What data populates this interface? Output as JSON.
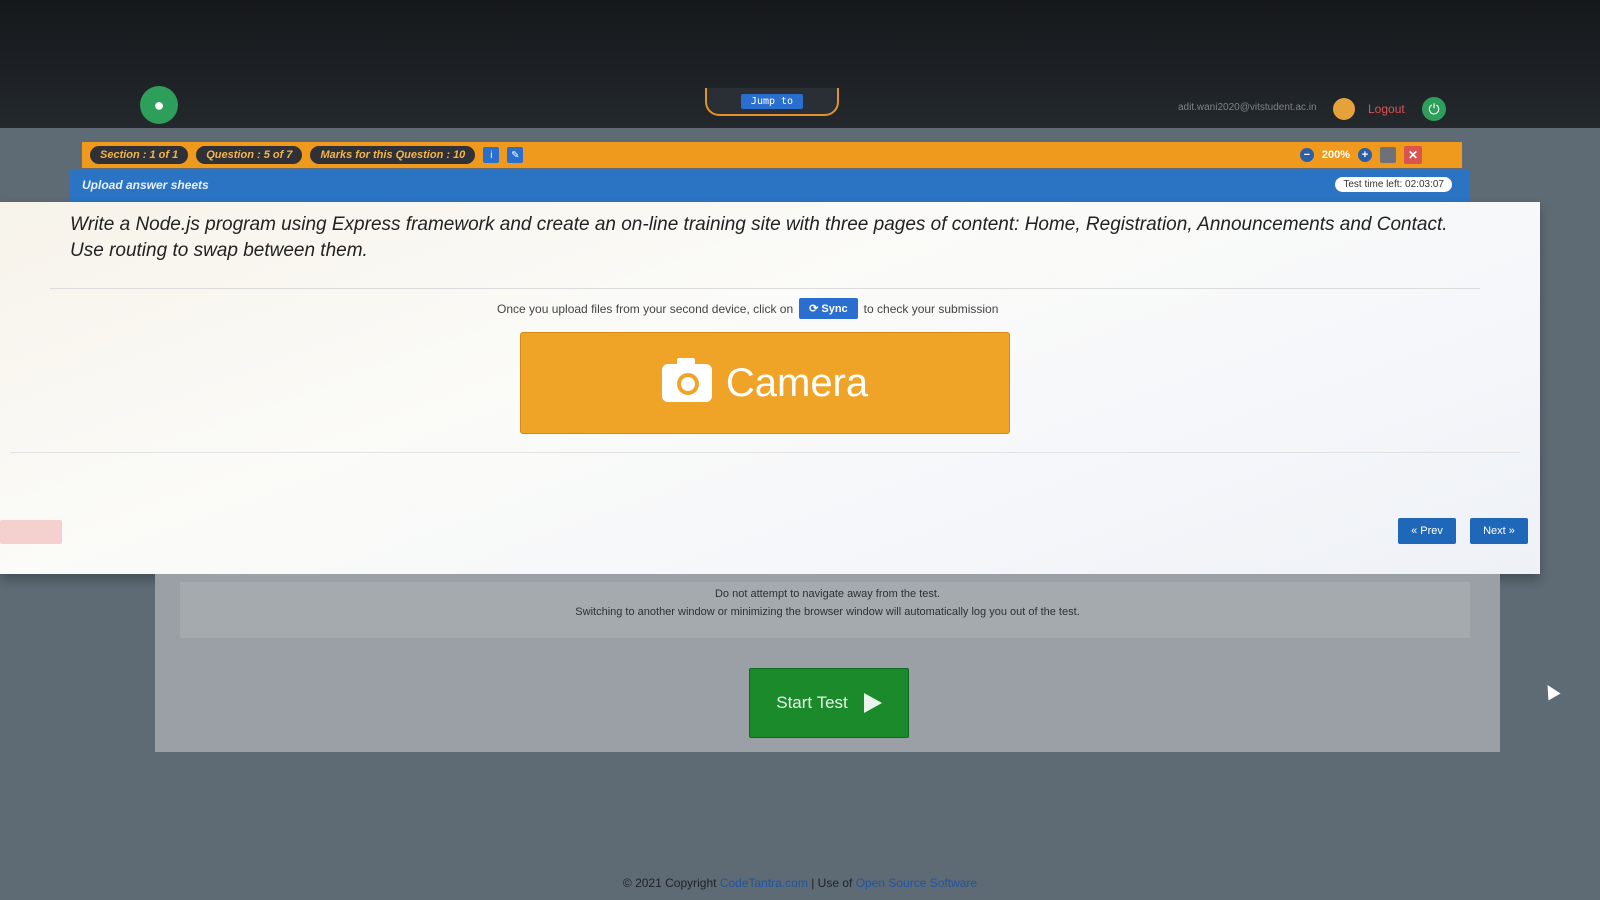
{
  "navbar": {
    "jump_label": "Jump to",
    "email": "adit.wani2020@vitstudent.ac.in",
    "logout_label": "Logout"
  },
  "section_bar": {
    "section": "Section : 1 of 1",
    "question": "Question : 5 of 7",
    "marks": "Marks for this Question : 10",
    "zoom": "200%"
  },
  "title_bar": {
    "title": "Upload answer sheets",
    "timer": "Test time left: 02:03:07"
  },
  "question_text": "Write a Node.js program using Express framework and create an on-line training site with three pages of content: Home, Registration, Announcements and Contact. Use routing to swap between them.",
  "upload": {
    "sync_prefix": "Once you upload files from your second device, click on",
    "sync_label": "Sync",
    "sync_suffix": "to check your submission",
    "camera_label": "Camera"
  },
  "navigation": {
    "prev_label": "« Prev",
    "next_label": "Next »"
  },
  "instructions": {
    "line1": "Do not attempt to navigate away from the test.",
    "line2": "Switching to another window or minimizing the browser window will automatically log you out of the test.",
    "start_label": "Start Test"
  },
  "footer": {
    "copyright": "© 2021 Copyright",
    "brand_link": "CodeTantra.com",
    "separator": "| Use of",
    "oss_link": "Open Source Software"
  },
  "colors": {
    "orange": "#ef9a1d",
    "blue": "#2b74c4",
    "green": "#1a8a2a",
    "camera": "#efa427"
  }
}
